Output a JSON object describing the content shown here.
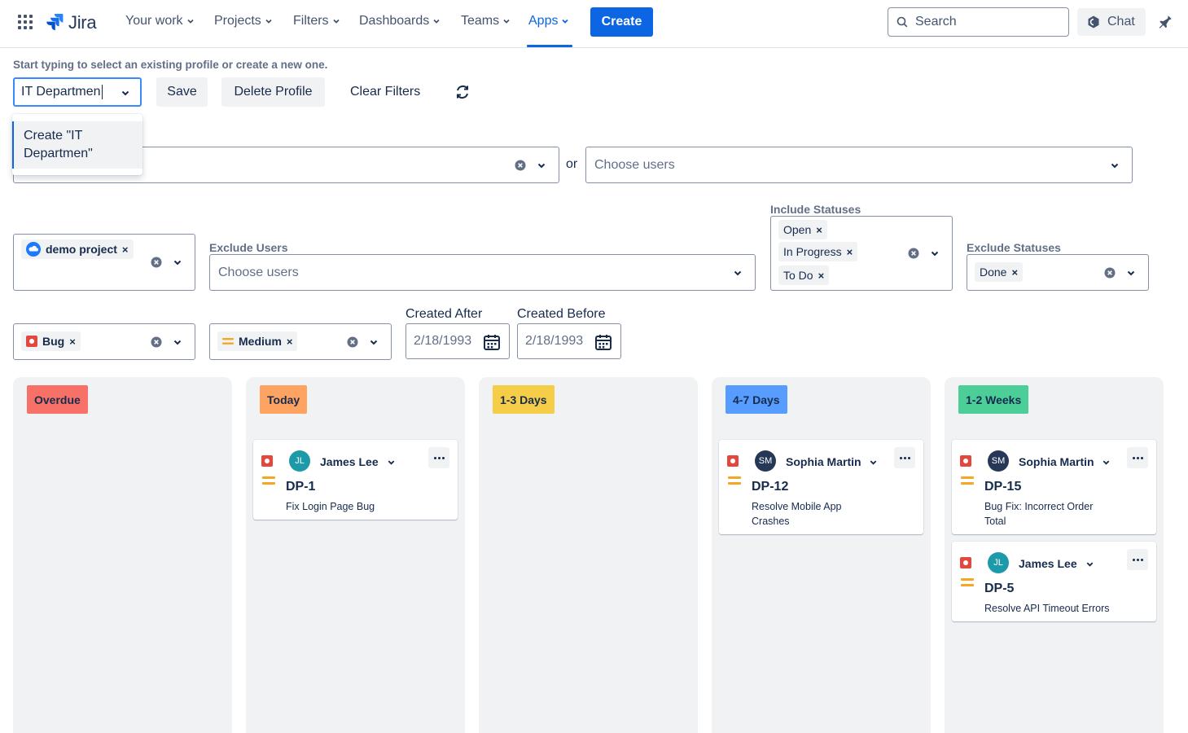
{
  "nav": {
    "app_name": "Jira",
    "items": [
      {
        "label": "Your work"
      },
      {
        "label": "Projects"
      },
      {
        "label": "Filters"
      },
      {
        "label": "Dashboards"
      },
      {
        "label": "Teams"
      },
      {
        "label": "Apps",
        "active": true
      }
    ],
    "create_label": "Create",
    "search_placeholder": "Search",
    "chat_label": "Chat"
  },
  "profile": {
    "hint": "Start typing to select an existing profile or create a new one.",
    "input_value": "IT Departmen",
    "save_label": "Save",
    "delete_label": "Delete Profile",
    "clear_label": "Clear Filters",
    "dropdown_option": "Create \"IT Departmen\""
  },
  "filters": {
    "or_text": "or",
    "choose_users_placeholder": "Choose users",
    "exclude_users_label": "Exclude Users",
    "exclude_users_placeholder": "Choose users",
    "include_statuses_label": "Include Statuses",
    "include_statuses": [
      "Open",
      "In Progress",
      "To Do"
    ],
    "exclude_statuses_label": "Exclude Statuses",
    "exclude_statuses": [
      "Done"
    ],
    "project_chip": "demo project",
    "issue_type_chip": "Bug",
    "priority_chip": "Medium",
    "created_after_label": "Created After",
    "created_after_value": "2/18/1993",
    "created_before_label": "Created Before",
    "created_before_value": "2/18/1993"
  },
  "board": {
    "columns": [
      {
        "label": "Overdue",
        "color": "#f87168"
      },
      {
        "label": "Today",
        "color": "#fea362"
      },
      {
        "label": "1-3 Days",
        "color": "#f5cd47"
      },
      {
        "label": "4-7 Days",
        "color": "#579dff"
      },
      {
        "label": "1-2 Weeks",
        "color": "#4bce97"
      }
    ],
    "cards": {
      "today": [
        {
          "assignee": "James Lee",
          "initials": "JL",
          "avatar_color": "#1d9aaa",
          "key": "DP-1",
          "summary": "Fix Login Page Bug"
        }
      ],
      "days_4_7": [
        {
          "assignee": "Sophia Martin",
          "initials": "SM",
          "avatar_color": "#253858",
          "key": "DP-12",
          "summary": "Resolve Mobile App Crashes"
        }
      ],
      "weeks_1_2": [
        {
          "assignee": "Sophia Martin",
          "initials": "SM",
          "avatar_color": "#253858",
          "key": "DP-15",
          "summary": "Bug Fix: Incorrect Order Total"
        },
        {
          "assignee": "James Lee",
          "initials": "JL",
          "avatar_color": "#1d9aaa",
          "key": "DP-5",
          "summary": "Resolve API Timeout Errors"
        }
      ]
    }
  }
}
